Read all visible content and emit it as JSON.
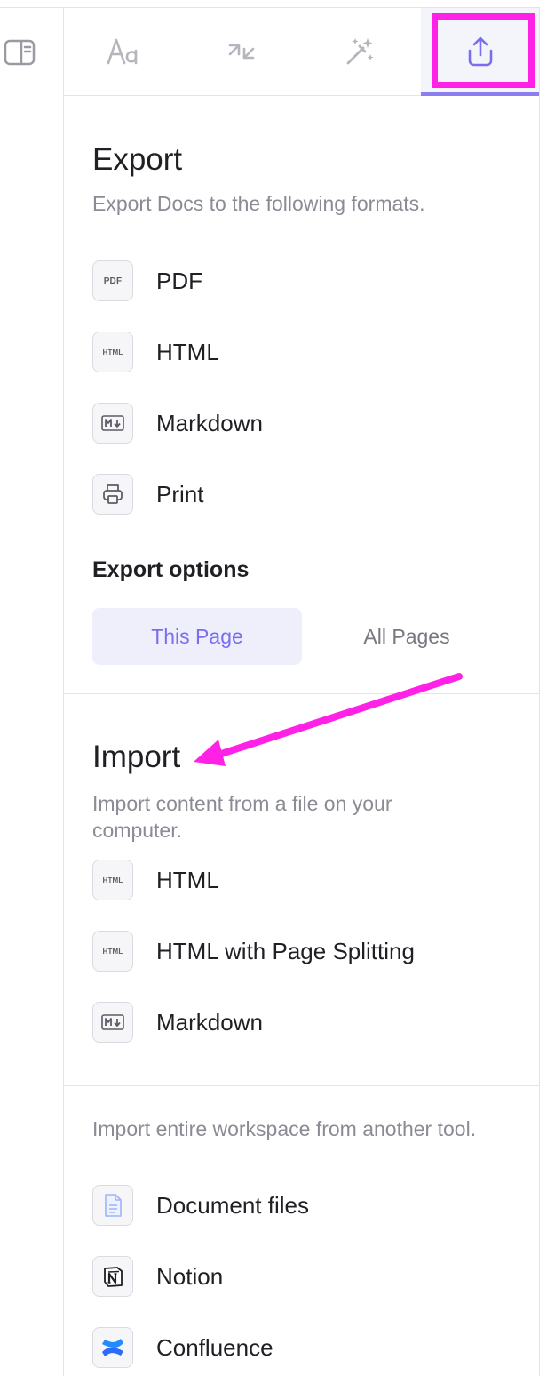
{
  "tabs": [
    {
      "icon": "typography-icon",
      "active": false
    },
    {
      "icon": "convert-arrows-icon",
      "active": false
    },
    {
      "icon": "magic-wand-icon",
      "active": false
    },
    {
      "icon": "share-upload-icon",
      "active": true
    }
  ],
  "export": {
    "title": "Export",
    "description": "Export Docs to the following formats.",
    "items": [
      {
        "label": "PDF",
        "badge": "PDF",
        "icon": "pdf-icon"
      },
      {
        "label": "HTML",
        "badge": "HTML",
        "icon": "html-icon"
      },
      {
        "label": "Markdown",
        "badge": "",
        "icon": "markdown-icon"
      },
      {
        "label": "Print",
        "badge": "",
        "icon": "printer-icon"
      }
    ],
    "options_title": "Export options",
    "options": [
      {
        "label": "This Page",
        "selected": true
      },
      {
        "label": "All Pages",
        "selected": false
      }
    ]
  },
  "import": {
    "title": "Import",
    "description": "Import content from a file on your computer.",
    "items": [
      {
        "label": "HTML",
        "badge": "HTML",
        "icon": "html-icon"
      },
      {
        "label": "HTML with Page Splitting",
        "badge": "HTML",
        "icon": "html-icon"
      },
      {
        "label": "Markdown",
        "badge": "",
        "icon": "markdown-icon"
      }
    ]
  },
  "workspace_import": {
    "description": "Import entire workspace from another tool.",
    "items": [
      {
        "label": "Document files",
        "icon": "document-file-icon"
      },
      {
        "label": "Notion",
        "icon": "notion-icon"
      },
      {
        "label": "Confluence",
        "icon": "confluence-icon"
      }
    ]
  },
  "colors": {
    "accent": "#8b7ff0",
    "annotation": "#ff21e6",
    "muted_text": "#8b8b95"
  }
}
